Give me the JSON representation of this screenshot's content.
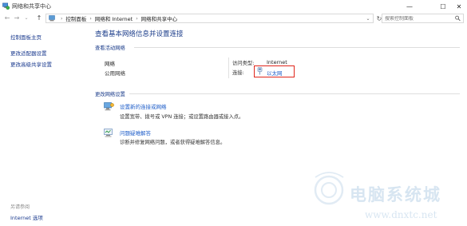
{
  "window": {
    "title": "网络和共享中心",
    "minimize_glyph": "—",
    "maximize_glyph": "☐",
    "close_glyph": "✕"
  },
  "nav": {
    "back_glyph": "←",
    "forward_glyph": "→",
    "history_glyph": "⌄",
    "up_glyph": "↑",
    "breadcrumb": [
      "控制面板",
      "网络和 Internet",
      "网络和共享中心"
    ],
    "separator": "›",
    "dropdown_glyph": "⌄",
    "refresh_glyph": "↻",
    "search_placeholder": "搜索控制面板"
  },
  "sidebar": {
    "items": [
      {
        "label": "控制面板主页"
      },
      {
        "label": "更改适配器设置"
      },
      {
        "label": "更改高级共享设置"
      }
    ],
    "see_also_heading": "另请参阅",
    "see_also_items": [
      {
        "label": "Internet 选项"
      }
    ]
  },
  "main": {
    "title": "查看基本网络信息并设置连接",
    "active_networks": {
      "heading": "查看活动网络",
      "network_name": "网络",
      "network_category": "公用网络",
      "access_type_label": "访问类型:",
      "access_type_value": "Internet",
      "connections_label": "连接:",
      "connection_value": "以太网"
    },
    "change_settings": {
      "heading": "更改网络设置",
      "tasks": [
        {
          "title": "设置新的连接或网络",
          "description": "设置宽带、拨号或 VPN 连接；或设置路由器或接入点。"
        },
        {
          "title": "问题疑难解答",
          "description": "诊断并修复网络问题，或者获得疑难解答信息。"
        }
      ]
    }
  },
  "watermark": {
    "text": "电脑系统城",
    "url": "www.dnxtc.net"
  },
  "colors": {
    "link": "#1b5bc8",
    "heading": "#1b3c8a",
    "highlight_box": "#e0261b"
  },
  "icons": {
    "app": "network-center-icon",
    "control_panel": "control-panel-icon",
    "connection": "ethernet-icon",
    "task1": "new-connection-icon",
    "task2": "troubleshoot-icon",
    "search": "search-icon"
  }
}
